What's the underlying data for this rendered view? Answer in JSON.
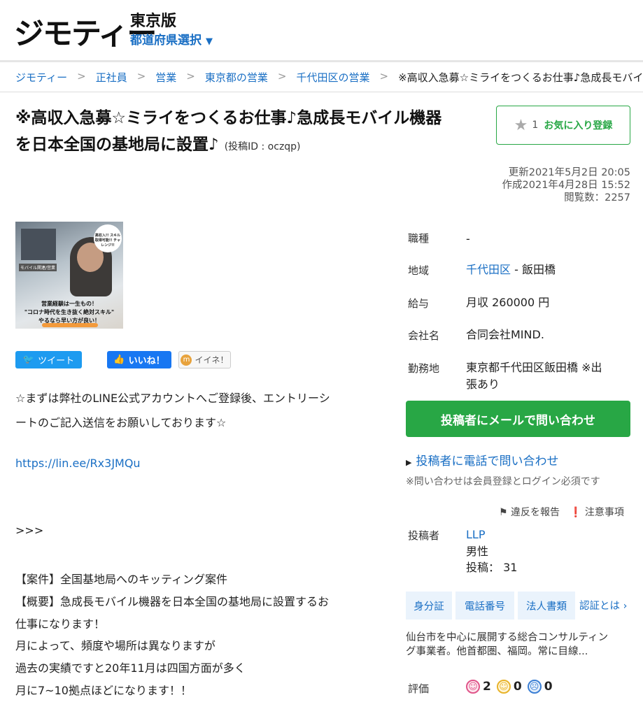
{
  "header": {
    "logo": "ジモティー",
    "region": "東京版",
    "prefecture_select": "都道府県選択",
    "chevron": "⌄"
  },
  "breadcrumb": {
    "items": [
      "ジモティー",
      "正社員",
      "営業",
      "東京都の営業",
      "千代田区の営業"
    ],
    "current": "※高収入急募☆ミライをつくるお仕事♪急成長モバイル"
  },
  "post": {
    "title": "※高収入急募☆ミライをつくるお仕事♪急成長モバイル機器を日本全国の基地局に設置♪",
    "post_id": "(投稿ID : oczqp)",
    "favorite_count": "1",
    "favorite_label": "お気に入り登録",
    "updated": "更新2021年5月2日 20:05",
    "created": "作成2021年4月28日 15:52",
    "views": "閲覧数：2257"
  },
  "thumbnail": {
    "badge": "高収入!! スキル取得可能!! チャレンジ!!",
    "tag": "モバイル関連/営業",
    "caption_1": "営業経験は一生もの！",
    "caption_2": "\"コロナ時代を生き抜く絶対スキル\"",
    "caption_3": "やるなら早い方が良い！"
  },
  "social": {
    "tweet": "ツイート",
    "like": "いいね！",
    "iine": "イイネ！"
  },
  "body": {
    "line1": "☆まずは弊社のLINE公式アカウントへご登録後、エントリーシ",
    "line2": "ートのご記入送信をお願いしております☆",
    "link": "https://lin.ee/Rx3JMQu",
    "arrows": ">>>",
    "p1": "【案件】全国基地局へのキッティング案件",
    "p2a": "【概要】急成長モバイル機器を日本全国の基地局に設置するお",
    "p2b": "仕事になります！",
    "p3": "月によって、頻度や場所は異なりますが",
    "p4": "過去の実績ですと20年11月は四国方面が多く",
    "p5": "月に7~10拠点ほどになります！！"
  },
  "details": {
    "job_type_label": "職種",
    "job_type": "-",
    "area_label": "地域",
    "area_link": "千代田区",
    "area_rest": " - 飯田橋",
    "salary_label": "給与",
    "salary": "月収 260000 円",
    "company_label": "会社名",
    "company": "合同会社MIND.",
    "location_label": "勤務地",
    "location_1": "東京都千代田区飯田橋 ※出",
    "location_2": "張あり"
  },
  "contact": {
    "mail_button": "投稿者にメールで問い合わせ",
    "phone_link": "投稿者に電話で問い合わせ",
    "requirement": "※問い合わせは会員登録とログイン必須です",
    "report": "違反を報告",
    "notes": "注意事項"
  },
  "poster": {
    "label": "投稿者",
    "name": "LLP",
    "gender": "男性",
    "posts": "投稿： 31",
    "chips": [
      "身分証",
      "電話番号",
      "法人書類"
    ],
    "cert_link": "認証とは",
    "description_1": "仙台市を中心に展開する総合コンサルティン",
    "description_2": "グ事業者。他首都圏、福岡。常に目線...",
    "rating_label": "評価",
    "rating_good": "2",
    "rating_normal": "0",
    "rating_bad": "0"
  },
  "colors": {
    "accent_green": "#28a745",
    "link_blue": "#1a6fc4",
    "twitter": "#1d9bf0",
    "facebook": "#1877f2"
  }
}
